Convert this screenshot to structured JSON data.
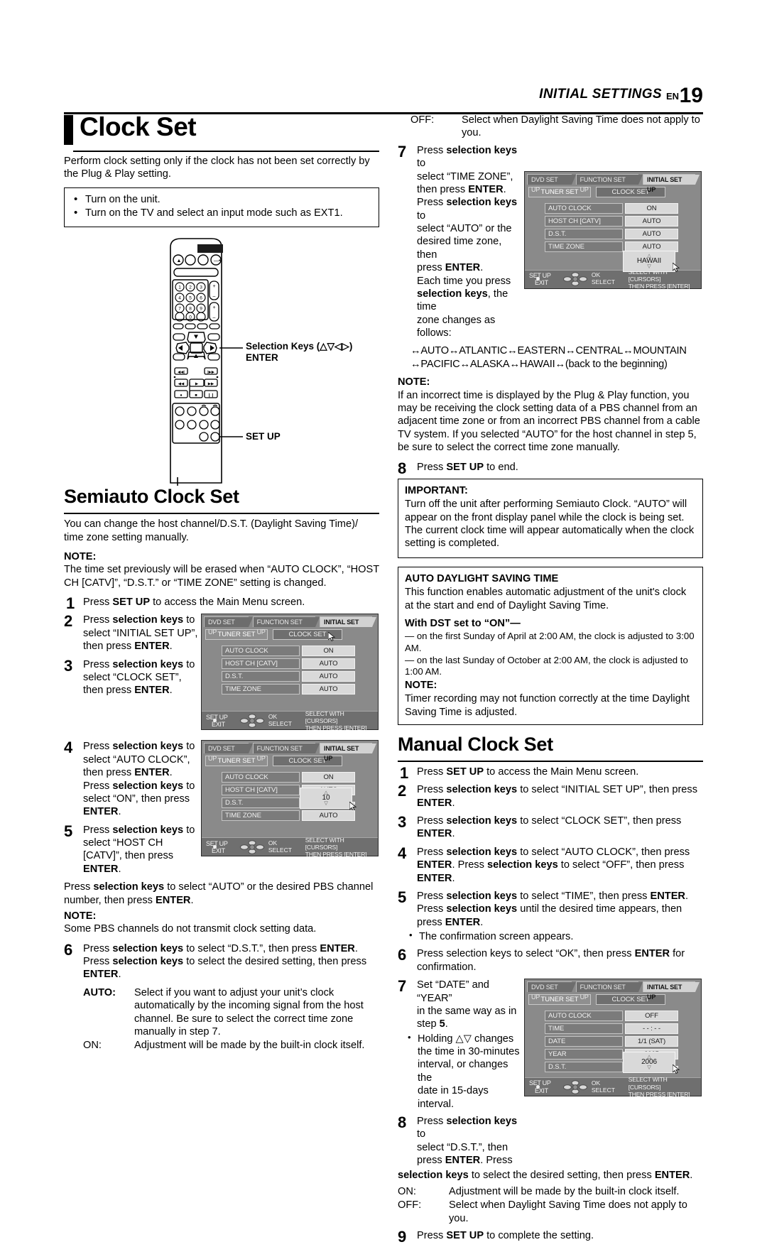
{
  "header": {
    "title": "INITIAL SETTINGS",
    "en": "EN",
    "page": "19"
  },
  "left": {
    "main_title": "Clock Set",
    "intro": "Perform clock setting only if the clock has not been set correctly by the Plug & Play setting.",
    "prep_bullets": [
      "Turn on the unit.",
      "Turn on the TV and select an input mode such as EXT1."
    ],
    "remote_labels": {
      "selection_keys": "Selection Keys (△▽◁▷)",
      "enter": "ENTER",
      "set_up": "SET UP"
    },
    "semiauto_title": "Semiauto Clock Set",
    "semiauto_intro": "You can change the host channel/D.S.T. (Daylight Saving Time)/ time zone setting manually.",
    "note_label": "NOTE:",
    "semiauto_note": "The time set previously will be erased when “AUTO CLOCK”, “HOST CH [CATV]”, “D.S.T.” or “TIME ZONE” setting is changed.",
    "steps": {
      "s1": "Press SET UP to access the Main Menu screen.",
      "s1_a": "Press ",
      "s1_b": "SET UP",
      "s1_c": " to access the Main Menu screen.",
      "s2_l1": "Press ",
      "s2_l1b": "selection keys",
      "s2_l1c": " to",
      "s2_l2": "select “INITIAL SET UP”,",
      "s2_l3a": "then press ",
      "s2_l3b": "ENTER",
      "s2_l3c": ".",
      "s3_l2": "select “CLOCK SET”,",
      "s4_l2": "select “AUTO CLOCK”,",
      "s4_l4a": "Press ",
      "s4_l4b": "selection keys",
      "s4_l4c": " to",
      "s4_l5": "select “ON”, then press",
      "s4_l6": "ENTER",
      "s5_l2": "select “HOST CH",
      "s5_l3": "[CATV]”, then press",
      "s5_l4": "ENTER",
      "s5_tail_a": "Press ",
      "s5_tail_b": "selection keys",
      "s5_tail_c": " to select “AUTO” or the desired PBS channel number, then press ",
      "s5_tail_d": "ENTER",
      "s5_tail_e": ".",
      "pbs_note": "Some PBS channels do not transmit clock setting data.",
      "s6_a": "Press ",
      "s6_b": "selection keys",
      "s6_c": " to select “D.S.T.”, then press ",
      "s6_d": "ENTER",
      "s6_e": ". Press ",
      "s6_f": "selection keys",
      "s6_g": " to select the desired setting, then press ",
      "s6_h": "ENTER",
      "s6_i": "."
    },
    "defs": [
      {
        "key": "AUTO:",
        "key_bold": true,
        "value": "Select if you want to adjust your unit’s clock automatically by the incoming signal from the host channel. Be sure to select the correct time zone manually in step 7."
      },
      {
        "key": "ON:",
        "key_bold": false,
        "value": "Adjustment will be made by the built-in clock itself."
      }
    ]
  },
  "right": {
    "off_key": "OFF:",
    "off_value": "Select when Daylight Saving Time does not apply to you.",
    "s7_l1a": "Press ",
    "s7_l1b": "selection keys",
    "s7_l1c": " to",
    "s7_l2": "select “TIME ZONE”,",
    "s7_l3a": "then press ",
    "s7_l3b": "ENTER",
    "s7_l3c": ".",
    "s7_l4a": "Press ",
    "s7_l4b": "selection keys",
    "s7_l4c": " to",
    "s7_l5": "select “AUTO” or the",
    "s7_l6": "desired time zone, then",
    "s7_l7a": "press ",
    "s7_l7b": "ENTER",
    "s7_l7c": ".",
    "s7_l8": "Each time you press",
    "s7_l9a": "selection keys",
    "s7_l9b": ", the time",
    "s7_l10": "zone changes as follows:",
    "zone_line1": "↔AUTO↔ATLANTIC↔EASTERN↔CENTRAL↔MOUNTAIN",
    "zone_line2": "↔PACIFIC↔ALASKA↔HAWAII↔(back to the beginning)",
    "note_label": "NOTE:",
    "note_7": "If an incorrect time is displayed by the Plug & Play function, you may be receiving the clock setting data of a PBS channel from an adjacent time zone or from an incorrect PBS channel from a cable TV system. If you selected “AUTO” for the host channel in step 5, be sure to select the correct time zone manually.",
    "s8_a": "Press ",
    "s8_b": "SET UP",
    "s8_c": " to end.",
    "important_label": "IMPORTANT:",
    "important_text": "Turn off the unit after performing Semiauto Clock. “AUTO” will appear on the front display panel while the clock is being set. The current clock time will appear automatically when the clock setting is completed.",
    "adst_title": "AUTO DAYLIGHT SAVING TIME",
    "adst_text": "This function enables automatic adjustment of the unit's clock at the start and end of Daylight Saving Time.",
    "dst_on_label": "With DST set to “ON”—",
    "dst_rule1": "— on the first Sunday of April at 2:00 AM, the clock is adjusted to 3:00 AM.",
    "dst_rule2": "— on the last Sunday of October at 2:00 AM, the clock is adjusted to 1:00 AM.",
    "adst_note": "Timer recording may not function correctly at the time Daylight Saving Time is adjusted.",
    "manual_title": "Manual Clock Set",
    "m1a": "Press ",
    "m1b": "SET UP",
    "m1c": " to access the Main Menu screen.",
    "m2a": "Press ",
    "m2b": "selection keys",
    "m2c": " to select “INITIAL SET UP”, then press ",
    "m2d": "ENTER",
    "m2e": ".",
    "m3a": "Press ",
    "m3b": "selection keys",
    "m3c": " to select “CLOCK SET”, then press ",
    "m3d": "ENTER",
    "m3e": ".",
    "m4a": "Press ",
    "m4b": "selection keys",
    "m4c": " to select “AUTO CLOCK”, then press ",
    "m4d": "ENTER",
    "m4e": ".",
    "m4f": "Press ",
    "m4g": "selection keys",
    "m4h": " to select “OFF”, then press ",
    "m4i": "ENTER",
    "m4j": ".",
    "m5a": "Press ",
    "m5b": "selection keys",
    "m5c": " to select “TIME”, then press ",
    "m5d": "ENTER",
    "m5e": ".",
    "m5f": "Press ",
    "m5g": "selection keys",
    "m5h": " until the desired time appears, then press ",
    "m5i": "ENTER",
    "m5j": ".",
    "m5_sub": "The confirmation screen appears.",
    "m6a": "Press selection keys to select “OK”, then press ",
    "m6b": "ENTER",
    "m6c": " for confirmation.",
    "m7_l1": "Set “DATE” and “YEAR”",
    "m7_l2": "in the same way as in",
    "m7_l3a": "step ",
    "m7_l3b": "5",
    "m7_l3c": ".",
    "m7_sub_l1": "Holding △▽ changes",
    "m7_sub_l2": "the time in 30-minutes",
    "m7_sub_l3": "interval, or changes the",
    "m7_sub_l4": "date in 15-days interval.",
    "m8_l1a": "Press ",
    "m8_l1b": "selection keys",
    "m8_l1c": " to",
    "m8_l2": "select “D.S.T.”, then",
    "m8_l3a": "press ",
    "m8_l3b": "ENTER",
    "m8_l3c": ". Press",
    "m8_tail_a": "selection keys",
    "m8_tail_b": " to select the desired setting, then press ",
    "m8_tail_c": "ENTER",
    "m8_tail_d": ".",
    "on_key": "ON:",
    "on_value": "Adjustment will be made by the built-in clock itself.",
    "off_key2": "OFF:",
    "off_value2": "Select when Daylight Saving Time does not apply to you.",
    "m9a": "Press ",
    "m9b": "SET UP",
    "m9c": " to complete the setting."
  },
  "osd": {
    "tabs": [
      "DVD SET UP",
      "FUNCTION SET UP",
      "INITIAL SET UP"
    ],
    "active_tab": "INITIAL SET UP",
    "buttons": [
      "TUNER SET",
      "CLOCK SET"
    ],
    "footer": {
      "setup": "SET UP",
      "exit": "EXIT",
      "ok": "OK",
      "select": "SELECT",
      "hint1": "SELECT WITH [CURSORS]",
      "hint2": "THEN PRESS [ENTER]"
    },
    "screen_timezone": {
      "rows": [
        {
          "label": "AUTO CLOCK",
          "value": "ON"
        },
        {
          "label": "HOST CH [CATV]",
          "value": "AUTO"
        },
        {
          "label": "D.S.T.",
          "value": "AUTO"
        },
        {
          "label": "TIME ZONE",
          "value": "AUTO"
        }
      ],
      "popup": "HAWAII"
    },
    "screen_clockset": {
      "rows": [
        {
          "label": "AUTO CLOCK",
          "value": "ON"
        },
        {
          "label": "HOST CH [CATV]",
          "value": "AUTO"
        },
        {
          "label": "D.S.T.",
          "value": "AUTO"
        },
        {
          "label": "TIME ZONE",
          "value": "AUTO"
        }
      ]
    },
    "screen_hostch": {
      "rows": [
        {
          "label": "AUTO CLOCK",
          "value": "ON"
        },
        {
          "label": "HOST CH [CATV]",
          "value": "AUTO"
        },
        {
          "label": "D.S.T.",
          "value": ""
        },
        {
          "label": "TIME ZONE",
          "value": "AUTO"
        }
      ],
      "popup": "10"
    },
    "screen_manual": {
      "rows": [
        {
          "label": "AUTO CLOCK",
          "value": "OFF"
        },
        {
          "label": "TIME",
          "value": "- - : - -"
        },
        {
          "label": "DATE",
          "value": "1/1 (SAT)"
        },
        {
          "label": "YEAR",
          "value": "2005"
        },
        {
          "label": "D.S.T.",
          "value": ""
        }
      ],
      "popup": "2006"
    }
  }
}
